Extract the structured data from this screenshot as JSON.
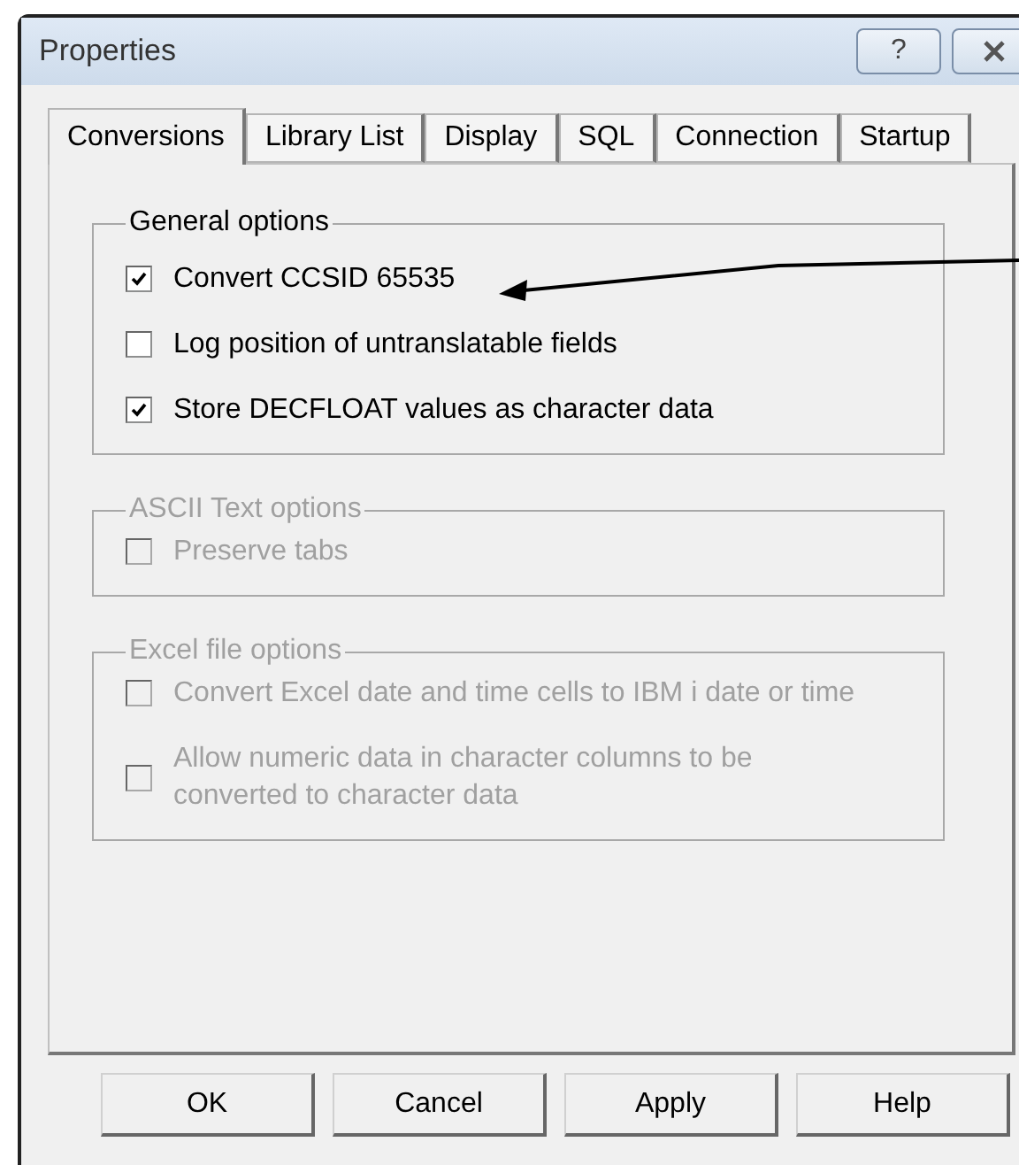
{
  "window": {
    "title": "Properties",
    "help_button": "?"
  },
  "tabs": [
    {
      "label": "Conversions",
      "selected": true
    },
    {
      "label": "Library List",
      "selected": false
    },
    {
      "label": "Display",
      "selected": false
    },
    {
      "label": "SQL",
      "selected": false
    },
    {
      "label": "Connection",
      "selected": false
    },
    {
      "label": "Startup",
      "selected": false
    }
  ],
  "groups": [
    {
      "title": "General options",
      "disabled": false,
      "options": [
        {
          "label": "Convert CCSID 65535",
          "checked": true
        },
        {
          "label": "Log position of untranslatable fields",
          "checked": false
        },
        {
          "label": "Store DECFLOAT values as character data",
          "checked": true
        }
      ]
    },
    {
      "title": "ASCII Text options",
      "disabled": true,
      "options": [
        {
          "label": "Preserve tabs",
          "checked": false
        }
      ]
    },
    {
      "title": "Excel file options",
      "disabled": true,
      "options": [
        {
          "label": "Convert Excel date and time cells to IBM i date or time",
          "checked": false
        },
        {
          "label": "Allow numeric data in character columns to be converted to character data",
          "checked": false
        }
      ]
    }
  ],
  "buttons": [
    "OK",
    "Cancel",
    "Apply",
    "Help"
  ]
}
